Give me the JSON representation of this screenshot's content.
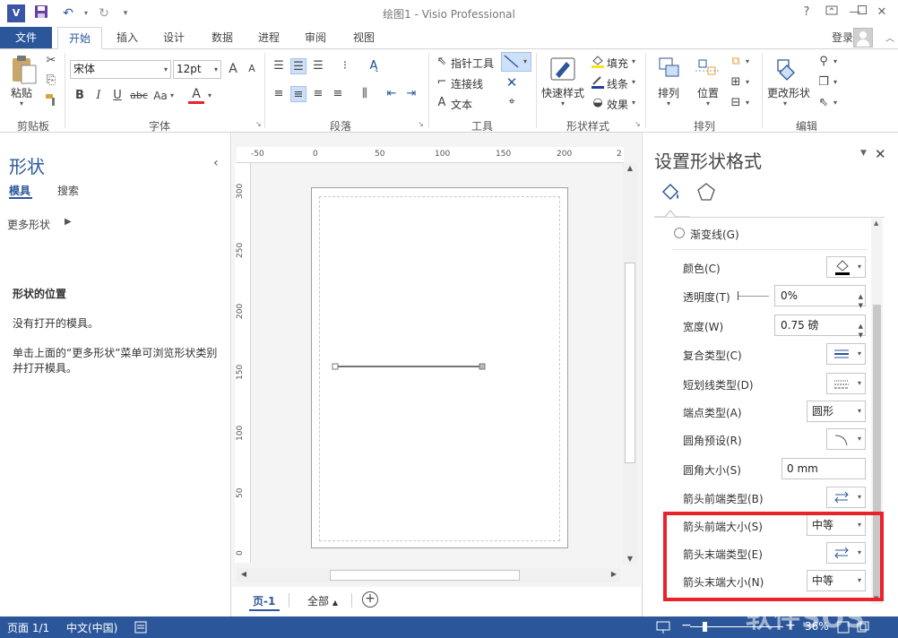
{
  "window": {
    "title": "绘图1 - Visio Professional",
    "help": "?",
    "min": "—",
    "max": "☐",
    "close": "✕"
  },
  "quick_access": {
    "app_icon": "V",
    "save": "💾",
    "undo": "↶",
    "redo": "↻",
    "customize": "▾"
  },
  "tabs": {
    "file": "文件",
    "items": [
      "开始",
      "插入",
      "设计",
      "数据",
      "进程",
      "审阅",
      "视图"
    ],
    "active": "开始",
    "signin": "登录"
  },
  "ribbon": {
    "clipboard": {
      "label": "剪贴板",
      "paste": "粘贴"
    },
    "font": {
      "label": "字体",
      "font_name": "宋体",
      "font_size": "12pt",
      "grow": "A",
      "shrink": "A",
      "bold": "B",
      "italic": "I",
      "underline": "U",
      "strike": "abc",
      "case": "Aa",
      "color": "A"
    },
    "paragraph": {
      "label": "段落"
    },
    "tools": {
      "label": "工具",
      "pointer": "指针工具",
      "connector": "连接线",
      "text": "文本",
      "text_glyph": "A"
    },
    "shape_styles": {
      "label": "形状样式",
      "quick_styles": "快速样式",
      "fill": "填充",
      "line": "线条",
      "effects": "效果"
    },
    "arrange": {
      "label": "排列",
      "arrange": "排列",
      "position": "位置"
    },
    "editing": {
      "label": "编辑",
      "change_shape": "更改形状"
    }
  },
  "shapes_panel": {
    "title": "形状",
    "tab_stencils": "模具",
    "tab_search": "搜索",
    "more_shapes": "更多形状",
    "heading": "形状的位置",
    "no_stencils": "没有打开的模具。",
    "hint": "单击上面的“更多形状”菜单可浏览形状类别并打开模具。",
    "collapse": "‹"
  },
  "canvas": {
    "ruler_h": [
      "-50",
      "0",
      "50",
      "100",
      "150",
      "200",
      "2"
    ],
    "ruler_v": [
      "300",
      "250",
      "200",
      "150",
      "100",
      "50",
      "0"
    ],
    "page_tab": "页-1",
    "all_pages": "全部",
    "all_arrow": "▲",
    "add_page": "+"
  },
  "format_panel": {
    "title": "设置形状格式",
    "gradient_line": "渐变线(G)",
    "rows": {
      "color": "颜色(C)",
      "transparency": "透明度(T)",
      "transparency_value": "0%",
      "width": "宽度(W)",
      "width_value": "0.75 磅",
      "compound": "复合类型(C)",
      "dash": "短划线类型(D)",
      "cap": "端点类型(A)",
      "cap_value": "圆形",
      "round_preset": "圆角预设(R)",
      "round_size": "圆角大小(S)",
      "round_size_value": "0 mm",
      "begin_type": "箭头前端类型(B)",
      "begin_size": "箭头前端大小(S)",
      "begin_size_value": "中等",
      "end_type": "箭头末端类型(E)",
      "end_size": "箭头末端大小(N)",
      "end_size_value": "中等"
    }
  },
  "statusbar": {
    "page": "页面 1/1",
    "lang": "中文(中国)",
    "zoom": "36%",
    "zoom_minus": "−",
    "zoom_plus": "+"
  },
  "watermark": "软件SOS",
  "colors": {
    "accent": "#2b579a",
    "highlight": "#e8232a"
  }
}
